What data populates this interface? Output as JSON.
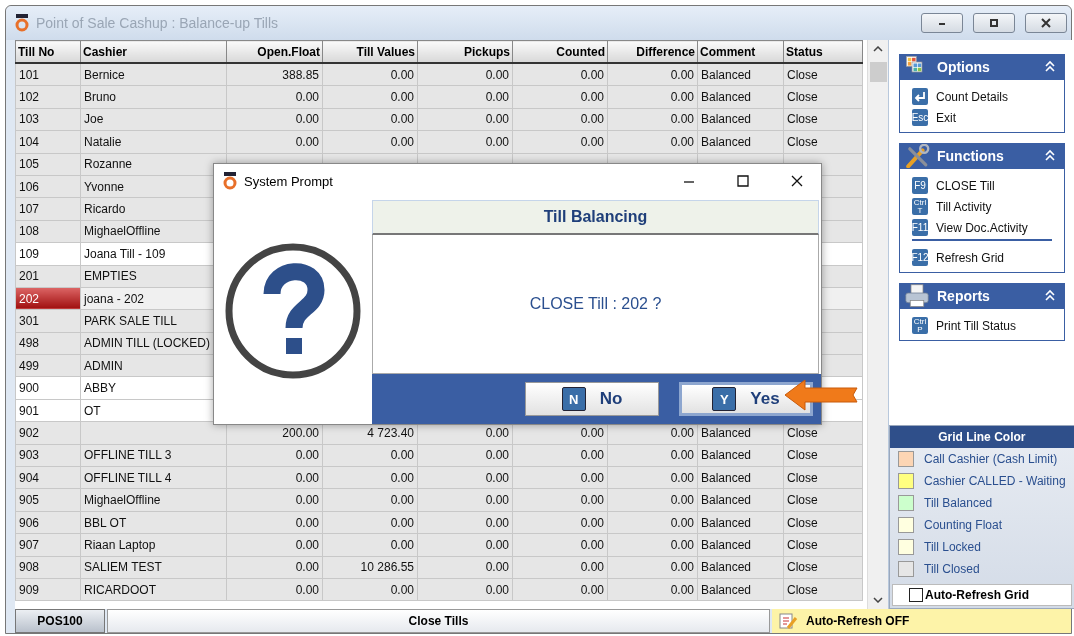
{
  "window": {
    "title": "Point of Sale Cashup : Balance-up Tills"
  },
  "table": {
    "columns": [
      "Till No",
      "Cashier",
      "Open.Float",
      "Till Values",
      "Pickups",
      "Counted",
      "Difference",
      "Comment",
      "Status"
    ],
    "rows": [
      {
        "cells": [
          "101",
          "Bernice",
          "388.85",
          "0.00",
          "0.00",
          "0.00",
          "0.00",
          "Balanced",
          "Close"
        ],
        "color": "#e6e6e6",
        "selected": false
      },
      {
        "cells": [
          "102",
          "Bruno",
          "0.00",
          "0.00",
          "0.00",
          "0.00",
          "0.00",
          "Balanced",
          "Close"
        ],
        "color": "#e6e6e6",
        "selected": false
      },
      {
        "cells": [
          "103",
          "Joe",
          "0.00",
          "0.00",
          "0.00",
          "0.00",
          "0.00",
          "Balanced",
          "Close"
        ],
        "color": "#e6e6e6",
        "selected": false
      },
      {
        "cells": [
          "104",
          "Natalie",
          "0.00",
          "0.00",
          "0.00",
          "0.00",
          "0.00",
          "Balanced",
          "Close"
        ],
        "color": "#e6e6e6",
        "selected": false
      },
      {
        "cells": [
          "105",
          "Rozanne"
        ],
        "color": "#e6e6e6",
        "selected": false
      },
      {
        "cells": [
          "106",
          "Yvonne"
        ],
        "color": "#e6e6e6",
        "selected": false
      },
      {
        "cells": [
          "107",
          "Ricardo"
        ],
        "color": "#e6e6e6",
        "selected": false
      },
      {
        "cells": [
          "108",
          "MighaelOffline"
        ],
        "color": "#e6e6e6",
        "selected": false
      },
      {
        "cells": [
          "109",
          "Joana Till - 109"
        ],
        "color": "#ffffff",
        "selected": false
      },
      {
        "cells": [
          "201",
          "EMPTIES"
        ],
        "color": "#e6e6e6",
        "selected": false
      },
      {
        "cells": [
          "202",
          "joana - 202"
        ],
        "color": "#f0f0f0",
        "selected": true
      },
      {
        "cells": [
          "301",
          "PARK SALE TILL"
        ],
        "color": "#e6e6e6",
        "selected": false
      },
      {
        "cells": [
          "498",
          "ADMIN TILL (LOCKED)"
        ],
        "color": "#e6e6e6",
        "selected": false
      },
      {
        "cells": [
          "499",
          "ADMIN"
        ],
        "color": "#e6e6e6",
        "selected": false
      },
      {
        "cells": [
          "900",
          "ABBY"
        ],
        "color": "#ffffff",
        "selected": false
      },
      {
        "cells": [
          "901",
          "OT"
        ],
        "color": "#ffffff",
        "selected": false
      },
      {
        "cells": [
          "902",
          "",
          "200.00",
          "4 723.40",
          "0.00",
          "0.00",
          "0.00",
          "Balanced",
          "Close"
        ],
        "color": "#e6e6e6",
        "selected": false
      },
      {
        "cells": [
          "903",
          "OFFLINE TILL 3",
          "0.00",
          "0.00",
          "0.00",
          "0.00",
          "0.00",
          "Balanced",
          "Close"
        ],
        "color": "#e6e6e6",
        "selected": false
      },
      {
        "cells": [
          "904",
          "OFFLINE TILL 4",
          "0.00",
          "0.00",
          "0.00",
          "0.00",
          "0.00",
          "Balanced",
          "Close"
        ],
        "color": "#e6e6e6",
        "selected": false
      },
      {
        "cells": [
          "905",
          "MighaelOffline",
          "0.00",
          "0.00",
          "0.00",
          "0.00",
          "0.00",
          "Balanced",
          "Close"
        ],
        "color": "#e6e6e6",
        "selected": false
      },
      {
        "cells": [
          "906",
          "BBL OT",
          "0.00",
          "0.00",
          "0.00",
          "0.00",
          "0.00",
          "Balanced",
          "Close"
        ],
        "color": "#e6e6e6",
        "selected": false
      },
      {
        "cells": [
          "907",
          "Riaan Laptop",
          "0.00",
          "0.00",
          "0.00",
          "0.00",
          "0.00",
          "Balanced",
          "Close"
        ],
        "color": "#e6e6e6",
        "selected": false
      },
      {
        "cells": [
          "908",
          "SALIEM TEST",
          "0.00",
          "10 286.55",
          "0.00",
          "0.00",
          "0.00",
          "Balanced",
          "Close"
        ],
        "color": "#e6e6e6",
        "selected": false
      },
      {
        "cells": [
          "909",
          "RICARDOOT",
          "0.00",
          "0.00",
          "0.00",
          "0.00",
          "0.00",
          "Balanced",
          "Close"
        ],
        "color": "#e6e6e6",
        "selected": false
      }
    ]
  },
  "side_panels": [
    {
      "title": "Options",
      "kind": "grid",
      "items": [
        {
          "kind": "enter",
          "label": "Count Details",
          "separator_after": false
        },
        {
          "kind": "key",
          "key_lines": [
            "Esc"
          ],
          "label": "Exit",
          "separator_after": false
        }
      ]
    },
    {
      "title": "Functions",
      "kind": "tools",
      "items": [
        {
          "kind": "key",
          "key_lines": [
            "F9"
          ],
          "label": "CLOSE Till",
          "separator_after": false
        },
        {
          "kind": "key",
          "key_lines": [
            "Ctrl",
            "T"
          ],
          "label": "Till Activity",
          "separator_after": false
        },
        {
          "kind": "key",
          "key_lines": [
            "F11"
          ],
          "label": "View Doc.Activity",
          "separator_after": true
        },
        {
          "kind": "key",
          "key_lines": [
            "F12"
          ],
          "label": "Refresh Grid",
          "separator_after": false
        }
      ]
    },
    {
      "title": "Reports",
      "kind": "printer",
      "items": [
        {
          "kind": "key",
          "key_lines": [
            "Ctrl",
            "P"
          ],
          "label": "Print Till Status",
          "separator_after": false
        }
      ]
    }
  ],
  "legend": {
    "title": "Grid Line Color",
    "items": [
      {
        "label": "Call Cashier (Cash Limit)",
        "color": "#fcd5b4"
      },
      {
        "label": "Cashier CALLED - Waiting",
        "color": "#ffff80"
      },
      {
        "label": "Till Balanced",
        "color": "#ccffcc"
      },
      {
        "label": "Counting Float",
        "color": "#ffffe0"
      },
      {
        "label": "Till Locked",
        "color": "#ffffe0"
      },
      {
        "label": "Till Closed",
        "color": "#e6e6e6"
      }
    ],
    "auto_refresh": {
      "label": "Auto-Refresh Grid",
      "checked": false
    }
  },
  "status_bar": {
    "terminal": "POS100",
    "screen": "Close Tills",
    "auto_refresh": "Auto-Refresh OFF"
  },
  "dialog": {
    "title": "System Prompt",
    "heading": "Till Balancing",
    "message": "CLOSE Till : 202 ?",
    "buttons": [
      {
        "key": "N",
        "label": "No",
        "focused": false
      },
      {
        "key": "Y",
        "label": "Yes",
        "focused": true
      }
    ]
  }
}
